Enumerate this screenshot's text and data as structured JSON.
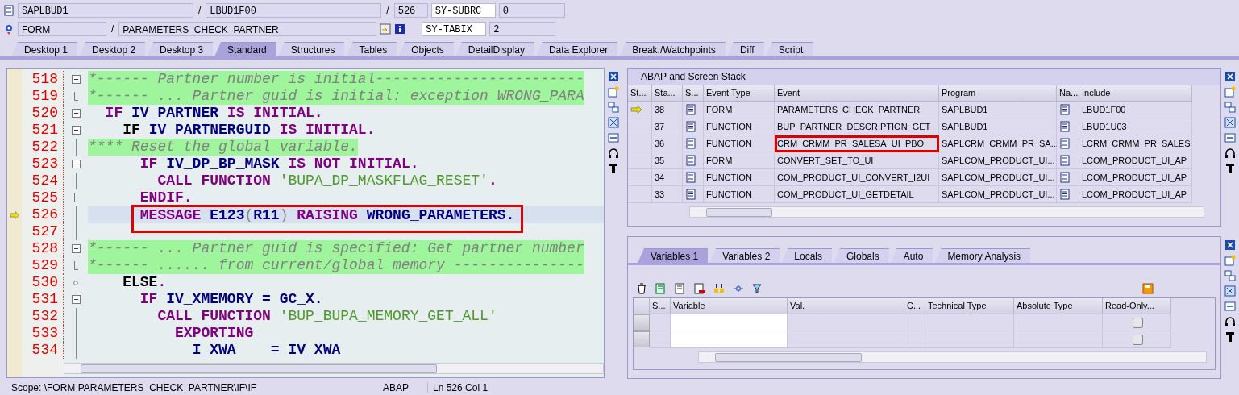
{
  "header": {
    "program": "SAPLBUD1",
    "include": "LBUD1F00",
    "line": "526",
    "event_type": "FORM",
    "event": "PARAMETERS_CHECK_PARTNER",
    "separators": [
      "/",
      "/",
      "/"
    ],
    "sysvars": [
      {
        "name": "SY-SUBRC",
        "value": "0"
      },
      {
        "name": "SY-TABIX",
        "value": "2"
      }
    ]
  },
  "tabs": [
    {
      "label": "Desktop 1",
      "selected": false
    },
    {
      "label": "Desktop 2",
      "selected": false
    },
    {
      "label": "Desktop 3",
      "selected": false
    },
    {
      "label": "Standard",
      "selected": true
    },
    {
      "label": "Structures",
      "selected": false
    },
    {
      "label": "Tables",
      "selected": false
    },
    {
      "label": "Objects",
      "selected": false
    },
    {
      "label": "DetailDisplay",
      "selected": false
    },
    {
      "label": "Data Explorer",
      "selected": false
    },
    {
      "label": "Break./Watchpoints",
      "selected": false
    },
    {
      "label": "Diff",
      "selected": false
    },
    {
      "label": "Script",
      "selected": false
    }
  ],
  "editor": {
    "lines": [
      {
        "number": "518",
        "kind": "open",
        "comment": true,
        "current": false,
        "annotated": false,
        "tokens": [
          {
            "kind": "comment",
            "text": "*------ Partner number is initial------------------------"
          }
        ]
      },
      {
        "number": "519",
        "kind": "close",
        "comment": true,
        "current": false,
        "annotated": false,
        "tokens": [
          {
            "kind": "comment",
            "text": "*------ ... Partner guid is initial: exception WRONG_PARA"
          }
        ]
      },
      {
        "number": "520",
        "kind": "open",
        "comment": false,
        "current": false,
        "annotated": false,
        "tokens": [
          {
            "kind": "keyword",
            "text": "  IF "
          },
          {
            "kind": "ident",
            "text": "IV_PARTNER "
          },
          {
            "kind": "keyword",
            "text": "IS INITIAL."
          }
        ]
      },
      {
        "number": "521",
        "kind": "open",
        "comment": false,
        "current": false,
        "annotated": false,
        "tokens": [
          {
            "kind": "plain",
            "text": "    IF "
          },
          {
            "kind": "ident",
            "text": "IV_PARTNERGUID "
          },
          {
            "kind": "keyword",
            "text": "IS INITIAL."
          }
        ]
      },
      {
        "number": "522",
        "kind": "inner",
        "comment": true,
        "current": false,
        "annotated": false,
        "tokens": [
          {
            "kind": "comment",
            "text": "**** Reset the global variable."
          }
        ]
      },
      {
        "number": "523",
        "kind": "open",
        "comment": false,
        "current": false,
        "annotated": false,
        "tokens": [
          {
            "kind": "keyword",
            "text": "      IF "
          },
          {
            "kind": "ident",
            "text": "IV_DP_BP_MASK "
          },
          {
            "kind": "keyword",
            "text": "IS NOT INITIAL."
          }
        ]
      },
      {
        "number": "524",
        "kind": "inner",
        "comment": false,
        "current": false,
        "annotated": false,
        "tokens": [
          {
            "kind": "keyword",
            "text": "        CALL FUNCTION "
          },
          {
            "kind": "string",
            "text": "'BUPA_DP_MASKFLAG_RESET'"
          },
          {
            "kind": "keyword",
            "text": "."
          }
        ]
      },
      {
        "number": "525",
        "kind": "close",
        "comment": false,
        "current": false,
        "annotated": false,
        "tokens": [
          {
            "kind": "keyword",
            "text": "      ENDIF."
          }
        ]
      },
      {
        "number": "526",
        "kind": "inner",
        "comment": false,
        "current": true,
        "annotated": true,
        "tokens": [
          {
            "kind": "keyword",
            "text": "      MESSAGE "
          },
          {
            "kind": "ident",
            "text": "E123"
          },
          {
            "kind": "paren",
            "text": "("
          },
          {
            "kind": "ident",
            "text": "R11"
          },
          {
            "kind": "paren",
            "text": ")"
          },
          {
            "kind": "keyword",
            "text": " RAISING "
          },
          {
            "kind": "ident",
            "text": "WRONG_PARAMETERS."
          }
        ]
      },
      {
        "number": "527",
        "kind": "inner",
        "current": false
      },
      {
        "number": "528",
        "kind": "open",
        "comment": true,
        "current": false,
        "annotated": false,
        "tokens": [
          {
            "kind": "comment",
            "text": "*------ ... Partner guid is specified: Get partner number"
          }
        ]
      },
      {
        "number": "529",
        "kind": "close",
        "comment": true,
        "current": false,
        "annotated": false,
        "tokens": [
          {
            "kind": "comment",
            "text": "*------ ...... from current/global memory ---------------"
          }
        ]
      },
      {
        "number": "530",
        "kind": "branch",
        "comment": false,
        "current": false,
        "annotated": false,
        "tokens": [
          {
            "kind": "plain",
            "text": "    ELSE"
          },
          {
            "kind": "keyword",
            "text": "."
          }
        ]
      },
      {
        "number": "531",
        "kind": "open",
        "comment": false,
        "current": false,
        "annotated": false,
        "tokens": [
          {
            "kind": "keyword",
            "text": "      IF "
          },
          {
            "kind": "ident",
            "text": "IV_XMEMORY = GC_X."
          }
        ]
      },
      {
        "number": "532",
        "kind": "inner",
        "comment": false,
        "current": false,
        "annotated": false,
        "tokens": [
          {
            "kind": "keyword",
            "text": "        CALL FUNCTION "
          },
          {
            "kind": "string",
            "text": "'BUP_BUPA_MEMORY_GET_ALL'"
          }
        ]
      },
      {
        "number": "533",
        "kind": "inner",
        "comment": false,
        "current": false,
        "annotated": false,
        "tokens": [
          {
            "kind": "keyword",
            "text": "          EXPORTING"
          }
        ]
      },
      {
        "number": "534",
        "kind": "inner",
        "comment": false,
        "current": false,
        "annotated": false,
        "tokens": [
          {
            "kind": "ident",
            "text": "            I_XWA    = IV_XWA"
          }
        ]
      }
    ],
    "status": {
      "scope": "Scope: \\FORM PARAMETERS_CHECK_PARTNER\\IF\\IF",
      "language": "ABAP",
      "position": "Ln 526 Col  1"
    }
  },
  "stack": {
    "title": "ABAP and Screen Stack",
    "columns": [
      "St...",
      "Sta...",
      "S...",
      "Event Type",
      "Event",
      "Program",
      "Na...",
      "Include"
    ],
    "rows": [
      {
        "current": true,
        "stack_level": "38",
        "event_type": "FORM",
        "event": "PARAMETERS_CHECK_PARTNER",
        "program": "SAPLBUD1",
        "include": "LBUD1F00",
        "annotated": false
      },
      {
        "current": false,
        "stack_level": "37",
        "event_type": "FUNCTION",
        "event": "BUP_PARTNER_DESCRIPTION_GET",
        "program": "SAPLBUD1",
        "include": "LBUD1U03",
        "annotated": false
      },
      {
        "current": false,
        "stack_level": "36",
        "event_type": "FUNCTION",
        "event": "CRM_CRMM_PR_SALESA_UI_PBO",
        "program": "SAPLCRM_CRMM_PR_SA...",
        "include": "LCRM_CRMM_PR_SALES",
        "annotated": true
      },
      {
        "current": false,
        "stack_level": "35",
        "event_type": "FORM",
        "event": "CONVERT_SET_TO_UI",
        "program": "SAPLCOM_PRODUCT_UI...",
        "include": "LCOM_PRODUCT_UI_AP",
        "annotated": false
      },
      {
        "current": false,
        "stack_level": "34",
        "event_type": "FUNCTION",
        "event": "COM_PRODUCT_UI_CONVERT_I2UI",
        "program": "SAPLCOM_PRODUCT_UI...",
        "include": "LCOM_PRODUCT_UI_AP",
        "annotated": false
      },
      {
        "current": false,
        "stack_level": "33",
        "event_type": "FUNCTION",
        "event": "COM_PRODUCT_UI_GETDETAIL",
        "program": "SAPLCOM_PRODUCT_UI...",
        "include": "LCOM_PRODUCT_UI_AP",
        "annotated": false
      }
    ]
  },
  "variables": {
    "tabs": [
      {
        "label": "Variables 1",
        "selected": true
      },
      {
        "label": "Variables 2",
        "selected": false
      },
      {
        "label": "Locals",
        "selected": false
      },
      {
        "label": "Globals",
        "selected": false
      },
      {
        "label": "Auto",
        "selected": false
      },
      {
        "label": "Memory Analysis",
        "selected": false
      }
    ],
    "columns": [
      "S...",
      "Variable",
      "Val.",
      "C...",
      "Technical Type",
      "Absolute Type",
      "Read-Only..."
    ],
    "rows": [
      {
        "read_only": false
      },
      {
        "read_only": false
      }
    ]
  }
}
